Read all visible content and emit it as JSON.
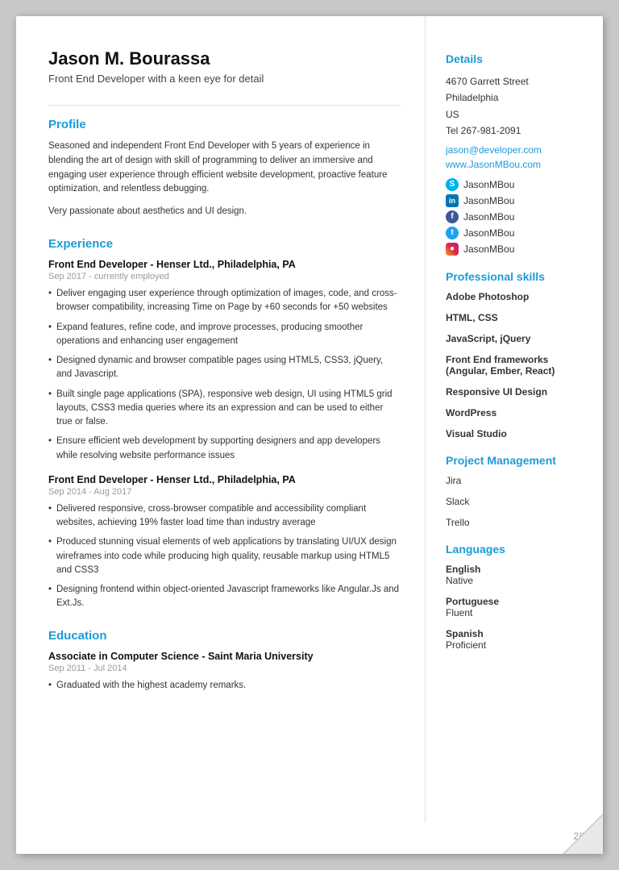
{
  "header": {
    "name": "Jason M. Bourassa",
    "title": "Front End Developer with a keen eye for detail"
  },
  "sections": {
    "profile": {
      "label": "Profile",
      "text1": "Seasoned and independent Front End Developer with 5 years of experience in blending the art of design with skill of programming to deliver an immersive and engaging user experience through efficient website development, proactive feature optimization, and relentless debugging.",
      "text2": "Very passionate about aesthetics and UI design."
    },
    "experience": {
      "label": "Experience",
      "jobs": [
        {
          "title": "Front End Developer - Henser Ltd., Philadelphia, PA",
          "date": "Sep 2017 - currently employed",
          "bullets": [
            "Deliver engaging user experience through optimization of images, code, and cross-browser compatibility, increasing Time on Page by +60 seconds for +50 websites",
            "Expand features, refine code, and improve processes, producing smoother operations and enhancing user engagement",
            "Designed dynamic and browser compatible pages using HTML5, CSS3, jQuery, and Javascript.",
            "Built single page applications (SPA), responsive web design, UI using HTML5 grid layouts, CSS3 media queries where its an expression and can be used to either true or false.",
            "Ensure efficient web development by supporting designers and app developers while resolving website performance issues"
          ]
        },
        {
          "title": "Front End Developer - Henser Ltd., Philadelphia, PA",
          "date": "Sep 2014 - Aug 2017",
          "bullets": [
            "Delivered responsive, cross-browser compatible and accessibility compliant websites, achieving 19% faster load time than industry average",
            "Produced stunning visual elements of web applications by translating UI/UX design wireframes into code while producing high quality, reusable markup using HTML5 and CSS3",
            "Designing frontend within object-oriented Javascript frameworks like Angular.Js and Ext.Js."
          ]
        }
      ]
    },
    "education": {
      "label": "Education",
      "items": [
        {
          "degree": "Associate in Computer Science - Saint Maria University",
          "date": "Sep 2011 - Jul 2014",
          "bullets": [
            "Graduated with the highest academy remarks."
          ]
        }
      ]
    }
  },
  "sidebar": {
    "details": {
      "label": "Details",
      "address1": "4670 Garrett Street",
      "address2": "Philadelphia",
      "address3": "US",
      "tel": "Tel 267-981-2091",
      "email": "jason@developer.com",
      "website": "www.JasonMBou.com"
    },
    "social": [
      {
        "platform": "Skype",
        "handle": "JasonMBou",
        "icon_type": "skype"
      },
      {
        "platform": "LinkedIn",
        "handle": "JasonMBou",
        "icon_type": "linkedin"
      },
      {
        "platform": "Facebook",
        "handle": "JasonMBou",
        "icon_type": "facebook"
      },
      {
        "platform": "Twitter",
        "handle": "JasonMBou",
        "icon_type": "twitter"
      },
      {
        "platform": "Instagram",
        "handle": "JasonMBou",
        "icon_type": "instagram"
      }
    ],
    "professional_skills": {
      "label": "Professional skills",
      "items": [
        "Adobe Photoshop",
        "HTML, CSS",
        "JavaScript, jQuery",
        "Front End frameworks (Angular, Ember, React)",
        "Responsive UI Design",
        "WordPress",
        "Visual Studio"
      ]
    },
    "project_management": {
      "label": "Project Management",
      "items": [
        "Jira",
        "Slack",
        "Trello"
      ]
    },
    "languages": {
      "label": "Languages",
      "items": [
        {
          "name": "English",
          "level": "Native"
        },
        {
          "name": "Portuguese",
          "level": "Fluent"
        },
        {
          "name": "Spanish",
          "level": "Proficient"
        }
      ]
    }
  },
  "page_number": "2/2"
}
